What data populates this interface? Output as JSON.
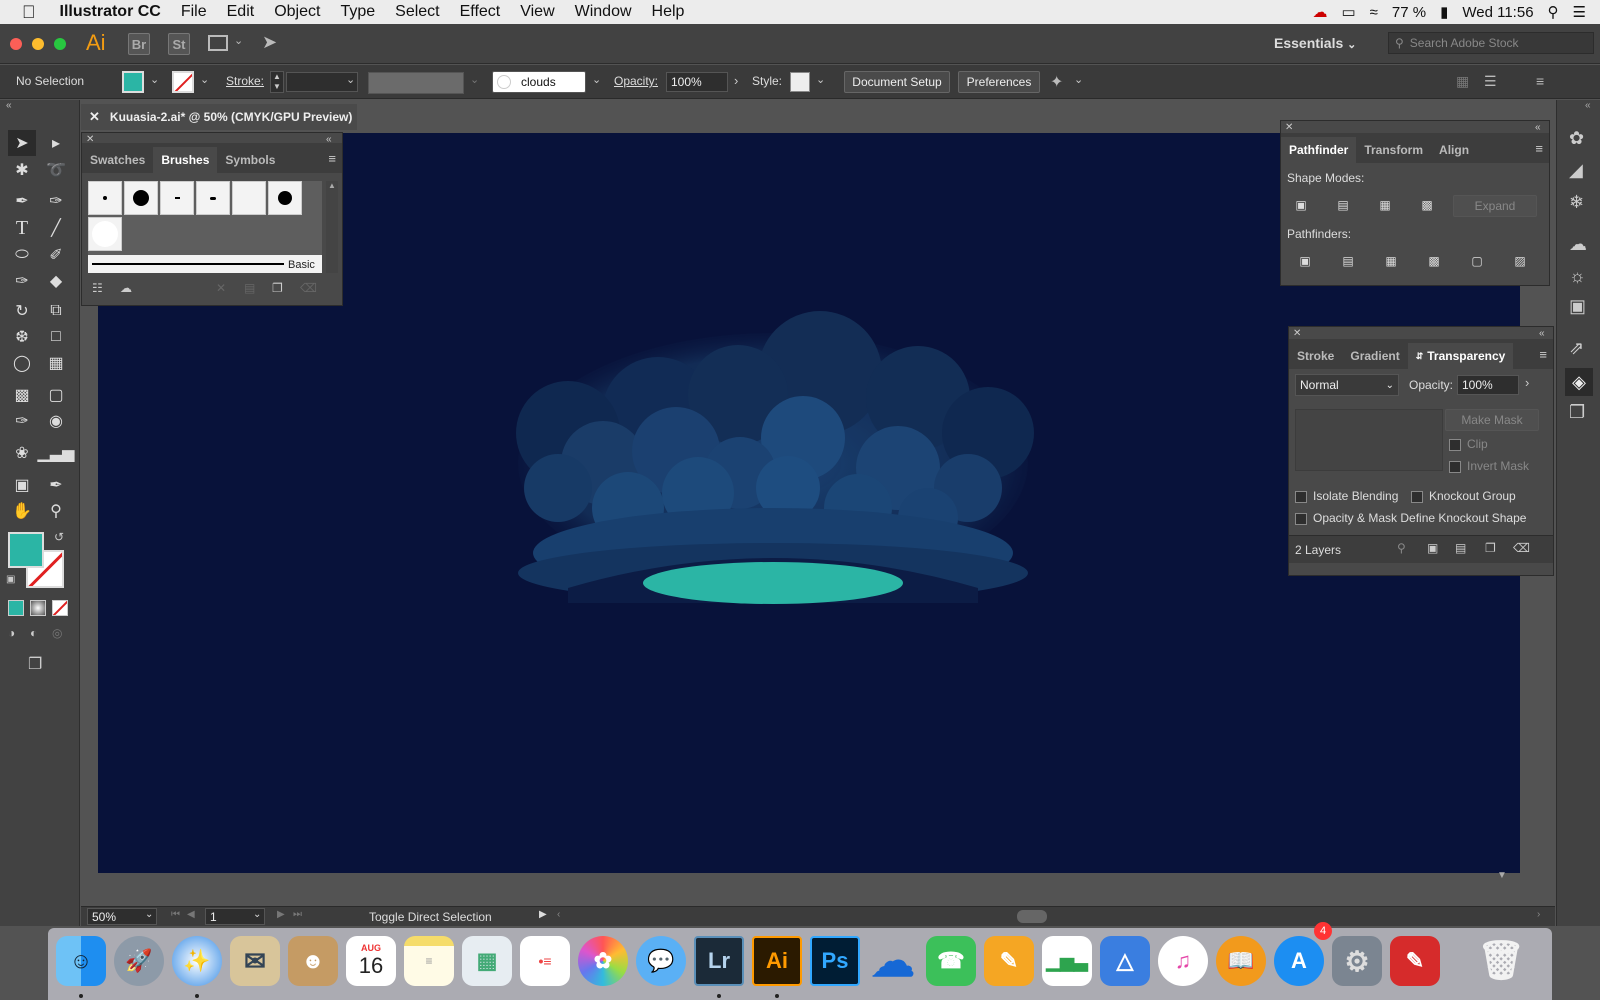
{
  "menubar": {
    "app_name": "Illustrator CC",
    "menus": [
      "File",
      "Edit",
      "Object",
      "Type",
      "Select",
      "Effect",
      "View",
      "Window",
      "Help"
    ],
    "battery": "77 %",
    "clock": "Wed 11:56"
  },
  "appbar": {
    "ai_label": "Ai",
    "bridge_label": "Br",
    "stock_label": "St",
    "workspace": "Essentials",
    "search_placeholder": "Search Adobe Stock"
  },
  "control": {
    "selection": "No Selection",
    "stroke_label": "Stroke:",
    "brush_name": "clouds",
    "opacity_label": "Opacity:",
    "opacity_value": "100%",
    "style_label": "Style:",
    "document_setup": "Document Setup",
    "preferences": "Preferences"
  },
  "document": {
    "tab_title": "Kuuasia-2.ai* @ 50% (CMYK/GPU Preview)"
  },
  "brushes_panel": {
    "tabs": [
      "Swatches",
      "Brushes",
      "Symbols"
    ],
    "active_tab": "Brushes",
    "basic_label": "Basic"
  },
  "pathfinder_panel": {
    "tabs": [
      "Pathfinder",
      "Transform",
      "Align"
    ],
    "shape_modes_label": "Shape Modes:",
    "expand_label": "Expand",
    "pathfinders_label": "Pathfinders:"
  },
  "transparency_panel": {
    "tabs": [
      "Stroke",
      "Gradient",
      "Transparency"
    ],
    "blend_mode": "Normal",
    "opacity_label": "Opacity:",
    "opacity_value": "100%",
    "make_mask": "Make Mask",
    "clip": "Clip",
    "invert_mask": "Invert Mask",
    "isolate_blending": "Isolate Blending",
    "knockout_group": "Knockout Group",
    "opacity_mask_knockout": "Opacity & Mask Define Knockout Shape",
    "layers_count": "2 Layers"
  },
  "statusbar": {
    "zoom": "50%",
    "artboard_number": "1",
    "status_text": "Toggle Direct Selection"
  },
  "dock": {
    "calendar_month": "AUG",
    "calendar_day": "16",
    "lr_label": "Lr",
    "ai_label": "Ai",
    "ps_label": "Ps",
    "appstore_badge": "4"
  },
  "colors": {
    "fill_color": "#2bb5a5",
    "artboard_bg": "#08123a",
    "cloud_dark": "#16355f",
    "cloud_light": "#1e4a7c"
  }
}
